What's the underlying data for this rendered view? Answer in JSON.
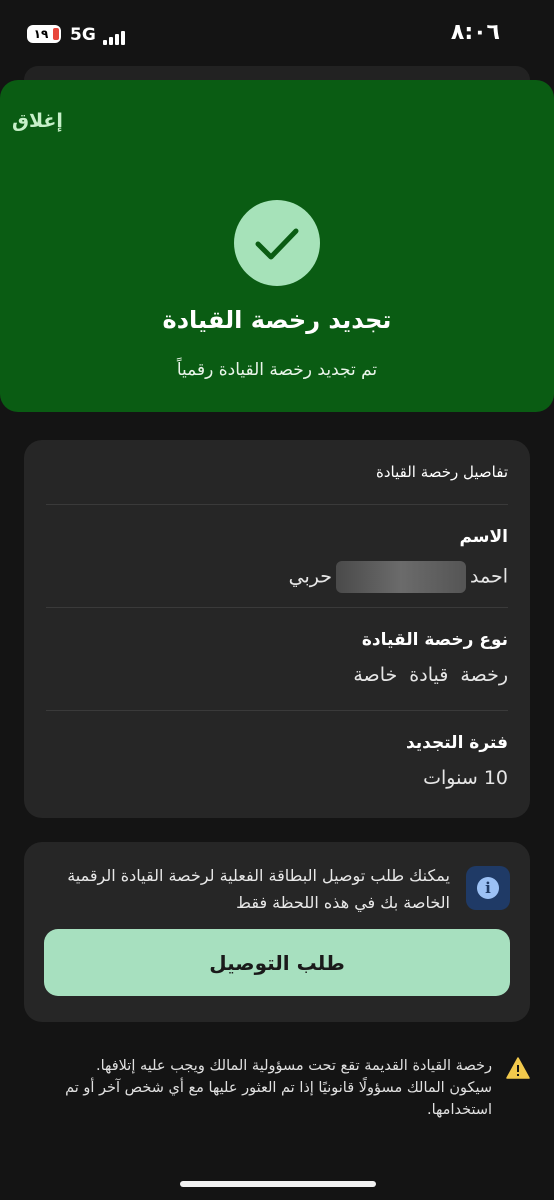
{
  "status_bar": {
    "time": "٨:٠٦",
    "battery": "١٩",
    "network": "5G"
  },
  "hero": {
    "close_label": "إغلاق",
    "title": "تجديد رخصة القيادة",
    "subtitle": "تم تجديد رخصة القيادة رقمياً",
    "icon": "check-icon"
  },
  "details": {
    "header": "تفاصيل رخصة القيادة",
    "rows": [
      {
        "label": "الاسم",
        "value_first": "احمد",
        "value_last": "حربي"
      },
      {
        "label": "نوع رخصة القيادة",
        "value": "رخصة  قيادة  خاصة"
      },
      {
        "label": "فترة التجديد",
        "value": "10 سنوات"
      }
    ]
  },
  "delivery": {
    "icon": "info-icon",
    "text": "يمكنك طلب توصيل البطاقة الفعلية لرخصة القيادة الرقمية الخاصة بك في هذه اللحظة فقط",
    "button_label": "طلب التوصيل"
  },
  "warning": {
    "icon": "warning-icon",
    "text": "رخصة القيادة القديمة تقع تحت مسؤولية المالك ويجب عليه إتلافها. سيكون المالك مسؤولًا قانونيًا إذا تم العثور عليها مع أي شخص آخر أو تم استخدامها."
  },
  "colors": {
    "hero_bg": "#0a5c13",
    "accent_button": "#a7e0bf",
    "card_bg": "#262626",
    "warning": "#f2c94c",
    "info_bg": "#1f3a66"
  }
}
